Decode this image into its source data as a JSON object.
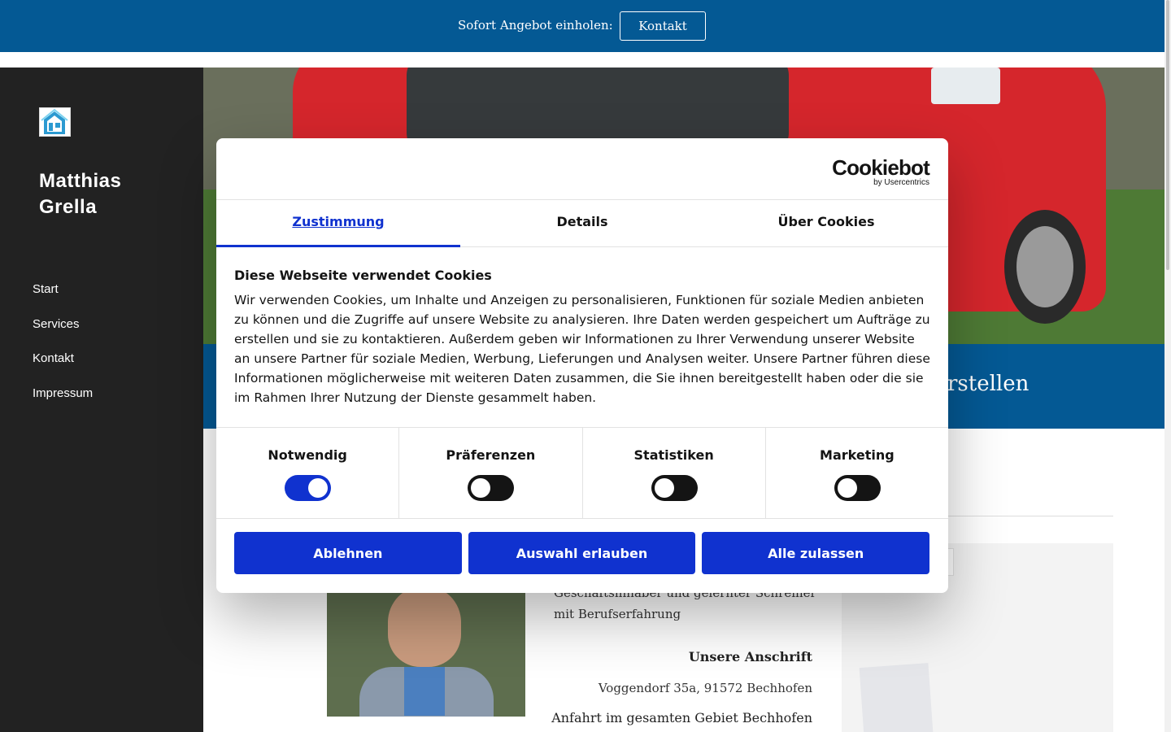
{
  "topbar": {
    "label": "Sofort Angebot einholen:",
    "button": "Kontakt",
    "background": "#045994"
  },
  "sidebar": {
    "brand": "Matthias Grella",
    "logo_icon": "house-logo-icon",
    "items": [
      {
        "label": "Start"
      },
      {
        "label": "Services"
      },
      {
        "label": "Kontakt"
      },
      {
        "label": "Impressum"
      }
    ]
  },
  "hero": {
    "slogan_fragment": "rstellen"
  },
  "about": {
    "text_line1": "Geschäftsinhaber und gelernter Schreiner",
    "text_line2": "mit Berufserfahrung",
    "address_title": "Unsere Anschrift",
    "address": "Voggendorf 35a, 91572 Bechhofen",
    "area": "Anfahrt im gesamten Gebiet Bechhofen"
  },
  "cookie_dialog": {
    "logo_name": "Cookiebot",
    "logo_by": "by Usercentrics",
    "tabs": [
      {
        "label": "Zustimmung",
        "active": true
      },
      {
        "label": "Details",
        "active": false
      },
      {
        "label": "Über Cookies",
        "active": false
      }
    ],
    "title": "Diese Webseite verwendet Cookies",
    "text": "Wir verwenden Cookies, um Inhalte und Anzeigen zu personalisieren, Funktionen für soziale Medien anbieten zu können und die Zugriffe auf unsere Website zu analysieren. Ihre Daten werden gespeichert um Aufträge zu erstellen und sie zu kontaktieren. Außerdem geben wir Informationen zu Ihrer Verwendung unserer Website an unsere Partner für soziale Medien, Werbung, Lieferungen und Analysen weiter. Unsere Partner führen diese Informationen möglicherweise mit weiteren Daten zusammen, die Sie ihnen bereitgestellt haben oder die sie im Rahmen Ihrer Nutzung der Dienste gesammelt haben.",
    "preferences": [
      {
        "label": "Notwendig",
        "enabled": true
      },
      {
        "label": "Präferenzen",
        "enabled": false
      },
      {
        "label": "Statistiken",
        "enabled": false
      },
      {
        "label": "Marketing",
        "enabled": false
      }
    ],
    "buttons": {
      "decline": "Ablehnen",
      "allow_selection": "Auswahl erlauben",
      "allow_all": "Alle zulassen"
    },
    "accent": "#1032cf"
  }
}
